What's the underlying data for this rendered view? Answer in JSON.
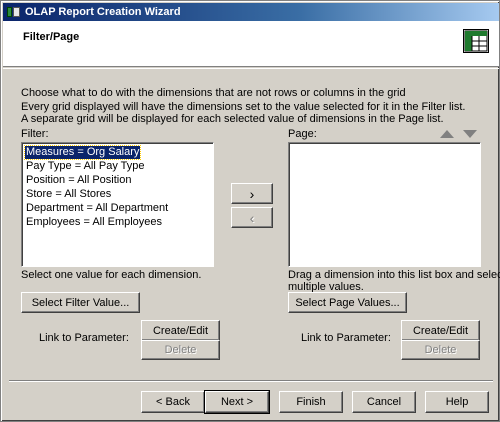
{
  "window": {
    "title": "OLAP Report Creation Wizard"
  },
  "header": {
    "title": "Filter/Page",
    "icon": "grid-icon"
  },
  "instructions": {
    "line1": "Choose what to do with the dimensions that are not rows or columns in the grid",
    "line2": "Every grid displayed will have the dimensions set to the value selected for it in the Filter list.",
    "line3": "A separate grid will be displayed for each selected value of dimensions in the Page list."
  },
  "filter": {
    "label": "Filter:",
    "items": [
      "Measures = Org Salary",
      "Pay Type = All Pay Type",
      "Position = All Position",
      "Store = All Stores",
      "Department = All Department",
      "Employees = All Employees"
    ],
    "selected_index": 0,
    "hint": "Select one value for each dimension.",
    "select_button": "Select Filter Value...",
    "link_label": "Link to Parameter:",
    "create_edit_button": "Create/Edit",
    "delete_button": "Delete"
  },
  "move": {
    "right_button": "›",
    "left_button": "‹"
  },
  "page": {
    "label": "Page:",
    "items": [],
    "hint_line1": "Drag a dimension into this list box and select",
    "hint_line2": "multiple values.",
    "select_button": "Select Page Values...",
    "link_label": "Link to Parameter:",
    "create_edit_button": "Create/Edit",
    "delete_button": "Delete",
    "up_icon": "arrow-up-icon",
    "down_icon": "arrow-down-icon"
  },
  "footer": {
    "back": "< Back",
    "next": "Next >",
    "finish": "Finish",
    "cancel": "Cancel",
    "help": "Help"
  },
  "colors": {
    "face": "#d4d0c8",
    "title_active": "#0a246a",
    "selection": "#0a246a"
  }
}
